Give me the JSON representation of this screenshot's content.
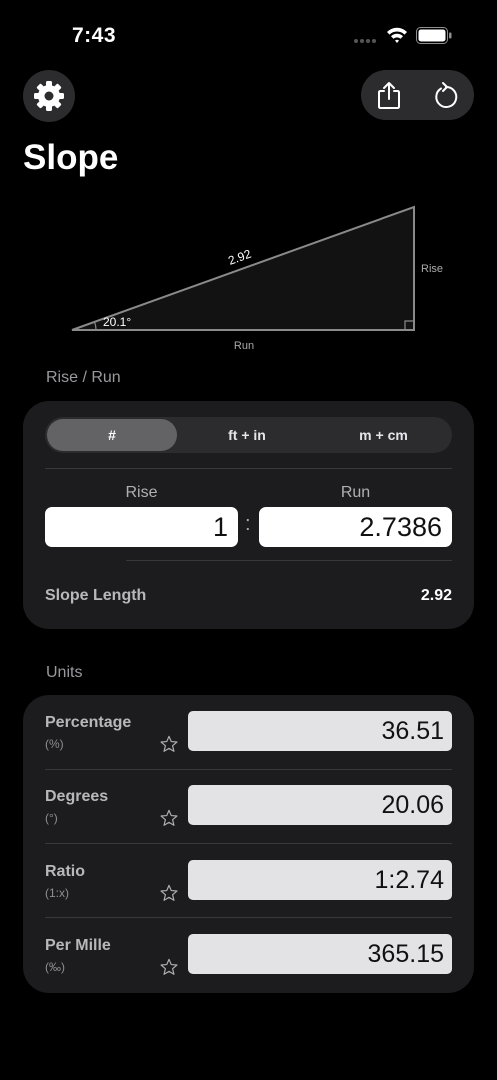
{
  "status": {
    "time": "7:43"
  },
  "icons": {
    "settings": "gear-icon",
    "share": "share-icon",
    "reset": "reset-icon",
    "star": "star-icon"
  },
  "header": {
    "title": "Slope"
  },
  "diagram": {
    "hypotenuse": "2.92",
    "angle": "20.1°",
    "rise_label": "Rise",
    "run_label": "Run"
  },
  "rise_run": {
    "section_label": "Rise / Run",
    "segments": [
      "#",
      "ft + in",
      "m + cm"
    ],
    "selected_segment": "#",
    "rise_label": "Rise",
    "run_label": "Run",
    "colon": ":",
    "rise_value": "1",
    "run_value": "2.7386",
    "slope_length_label": "Slope Length",
    "slope_length_value": "2.92"
  },
  "units": {
    "section_label": "Units",
    "rows": [
      {
        "name": "Percentage",
        "symbol": "(%)",
        "value": "36.51"
      },
      {
        "name": "Degrees",
        "symbol": "(°)",
        "value": "20.06"
      },
      {
        "name": "Ratio",
        "symbol": "(1:x)",
        "value": "1:2.74"
      },
      {
        "name": "Per Mille",
        "symbol": "(‰)",
        "value": "365.15"
      }
    ]
  },
  "colors": {
    "background": "#000000",
    "card": "#1c1c1e",
    "segment_active": "#636366",
    "input": "#ffffff",
    "unit_input": "#e3e3e6"
  }
}
